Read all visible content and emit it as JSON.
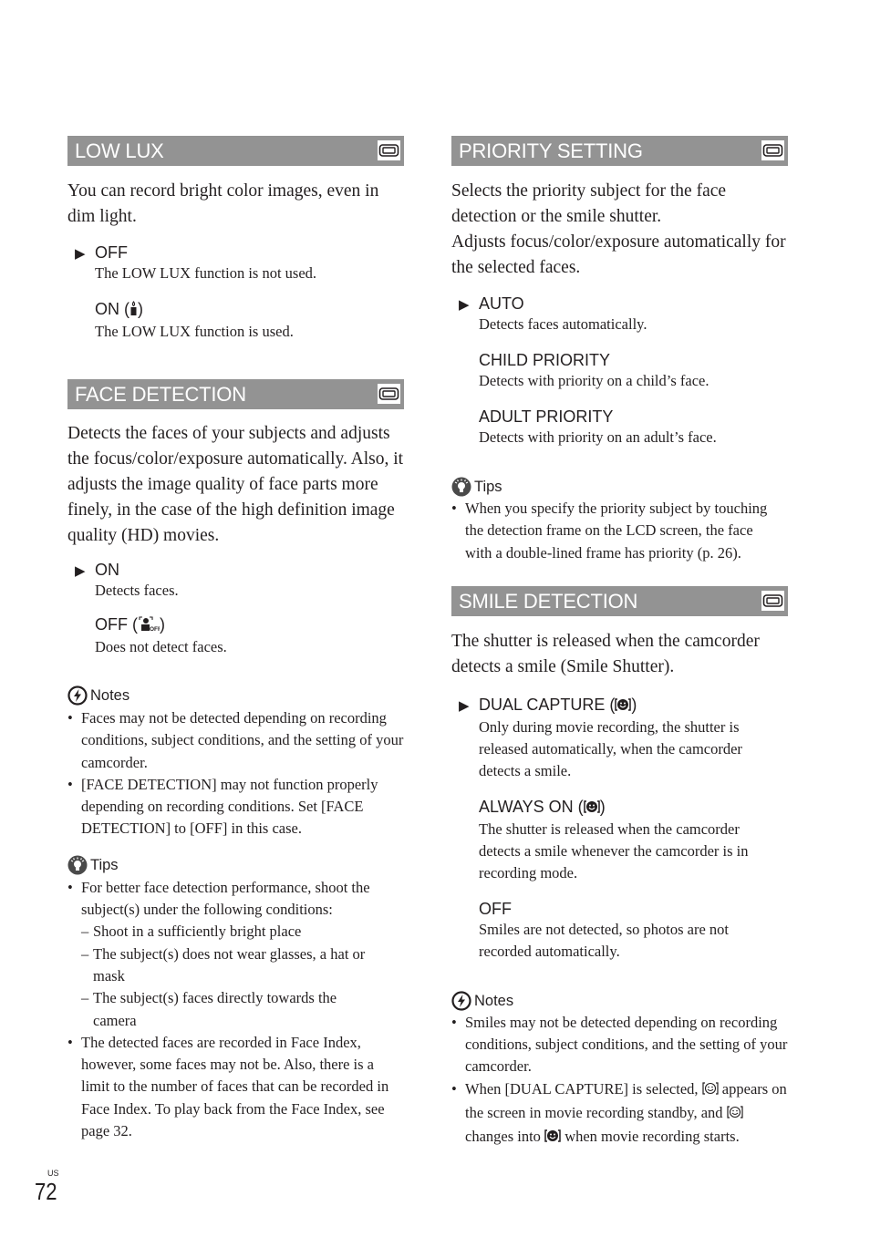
{
  "page": {
    "region": "US",
    "number": "72"
  },
  "left_column": {
    "low_lux": {
      "title": "LOW LUX",
      "icon": "movie-camera-icon",
      "intro": "You can record bright color images, even in dim light.",
      "options": [
        {
          "label": "OFF",
          "default": true,
          "description": "The LOW LUX function is not used."
        },
        {
          "label": "ON (",
          "icon": "candle-icon",
          "label_end": ")",
          "default": false,
          "description": "The LOW LUX function is used."
        }
      ]
    },
    "face_detection": {
      "title": "FACE DETECTION",
      "icon": "movie-camera-icon",
      "intro": "Detects the faces of your subjects and adjusts the focus/color/exposure automatically. Also, it adjusts the image quality of face parts more finely, in the case of the high definition image quality (HD) movies.",
      "options": [
        {
          "label": "ON",
          "default": true,
          "description": "Detects faces."
        },
        {
          "label": "OFF (",
          "icon": "face-detection-off-icon",
          "label_end": ")",
          "default": false,
          "description": "Does not detect faces."
        }
      ],
      "notes": {
        "heading": "Notes",
        "icon": "notes-icon",
        "items": [
          "Faces may not be detected depending on recording conditions, subject conditions, and the setting of your camcorder.",
          "[FACE DETECTION] may not function properly depending on recording conditions. Set [FACE DETECTION] to [OFF] in this case."
        ]
      },
      "tips": {
        "heading": "Tips",
        "icon": "tips-icon",
        "items": [
          {
            "text": "For better face detection performance, shoot the subject(s) under the following conditions:",
            "sub": [
              "Shoot in a sufficiently bright place",
              "The subject(s) does not wear glasses, a hat or mask",
              "The subject(s) faces directly towards the camera"
            ]
          },
          {
            "text": "The detected faces are recorded in Face Index, however, some faces may not be. Also, there is a limit to the number of faces that can be recorded in Face Index. To play back from the Face Index, see page 32."
          }
        ]
      }
    }
  },
  "right_column": {
    "priority_setting": {
      "title": "PRIORITY SETTING",
      "icon": "movie-camera-icon",
      "intro": "Selects the priority subject for the face detection or the smile shutter.",
      "intro2": "Adjusts focus/color/exposure automatically for the selected faces.",
      "options": [
        {
          "label": "AUTO",
          "default": true,
          "description": "Detects faces automatically."
        },
        {
          "label": "CHILD PRIORITY",
          "default": false,
          "description": "Detects with priority on a child’s face."
        },
        {
          "label": "ADULT PRIORITY",
          "default": false,
          "description": "Detects with priority on an adult’s face."
        }
      ],
      "tips": {
        "heading": "Tips",
        "icon": "tips-icon",
        "items": [
          "When you specify the priority subject by touching the detection frame on the LCD screen, the face with a double-lined frame has priority (p. 26)."
        ]
      }
    },
    "smile_detection": {
      "title": "SMILE DETECTION",
      "icon": "movie-camera-icon",
      "intro": "The shutter is released when the camcorder detects a smile (Smile Shutter).",
      "options": [
        {
          "label": "DUAL CAPTURE (",
          "icon": "smile-shutter-icon",
          "label_end": ")",
          "default": true,
          "description": "Only during movie recording, the shutter is released automatically, when the camcorder detects a smile."
        },
        {
          "label": "ALWAYS ON (",
          "icon": "smile-shutter-icon",
          "label_end": ")",
          "default": false,
          "description": "The shutter is released when the camcorder detects a smile whenever the camcorder is in recording mode."
        },
        {
          "label": "OFF",
          "default": false,
          "description": "Smiles are not detected, so photos are not recorded automatically."
        }
      ],
      "notes": {
        "heading": "Notes",
        "icon": "notes-icon",
        "items": [
          {
            "text": "Smiles may not be detected depending on recording conditions, subject conditions, and the setting of your camcorder."
          },
          {
            "part1": " When [DUAL CAPTURE] is selected, ",
            "icon1": "smile-standby-icon",
            "part2": " appears on the screen in movie recording standby, and ",
            "icon2": "smile-standby-icon",
            "part3": " changes into ",
            "icon3": "smile-shutter-icon",
            "part4": " when movie recording starts."
          }
        ]
      }
    }
  },
  "default_marker": "▶"
}
